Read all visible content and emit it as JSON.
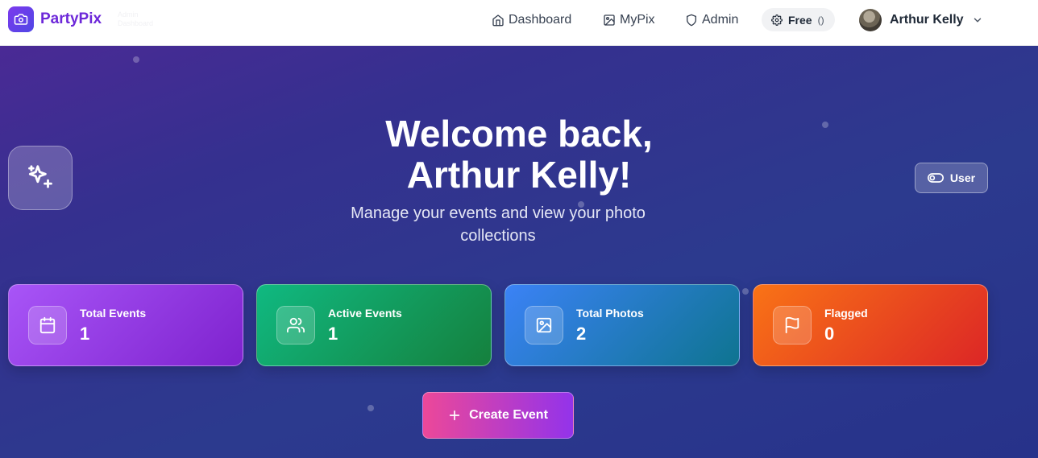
{
  "header": {
    "brand": "PartyPix",
    "brand_sub_line1": "Admin",
    "brand_sub_line2": "Dashboard",
    "nav": [
      {
        "label": "Dashboard",
        "icon": "home-icon"
      },
      {
        "label": "MyPix",
        "icon": "image-icon"
      },
      {
        "label": "Admin",
        "icon": "shield-icon"
      }
    ],
    "plan": {
      "label": "Free",
      "count": "()"
    },
    "user_name": "Arthur Kelly"
  },
  "hero": {
    "title_line1": "Welcome back,",
    "title_line2": "Arthur Kelly!",
    "subtitle": "Manage your events and view your photo collections",
    "role_label": "User"
  },
  "stats": [
    {
      "label": "Total Events",
      "value": "1",
      "icon": "calendar-icon",
      "color_from": "#a855f7",
      "color_to": "#7e22ce"
    },
    {
      "label": "Active Events",
      "value": "1",
      "icon": "users-icon",
      "color_from": "#10b981",
      "color_to": "#15803d"
    },
    {
      "label": "Total Photos",
      "value": "2",
      "icon": "image-icon",
      "color_from": "#3b82f6",
      "color_to": "#0e7490"
    },
    {
      "label": "Flagged",
      "value": "0",
      "icon": "flag-icon",
      "color_from": "#f97316",
      "color_to": "#dc2626"
    }
  ],
  "create_button": "Create Event",
  "colors": {
    "accent": "#6d28d9",
    "hero_bg": "#2c3a8e"
  }
}
